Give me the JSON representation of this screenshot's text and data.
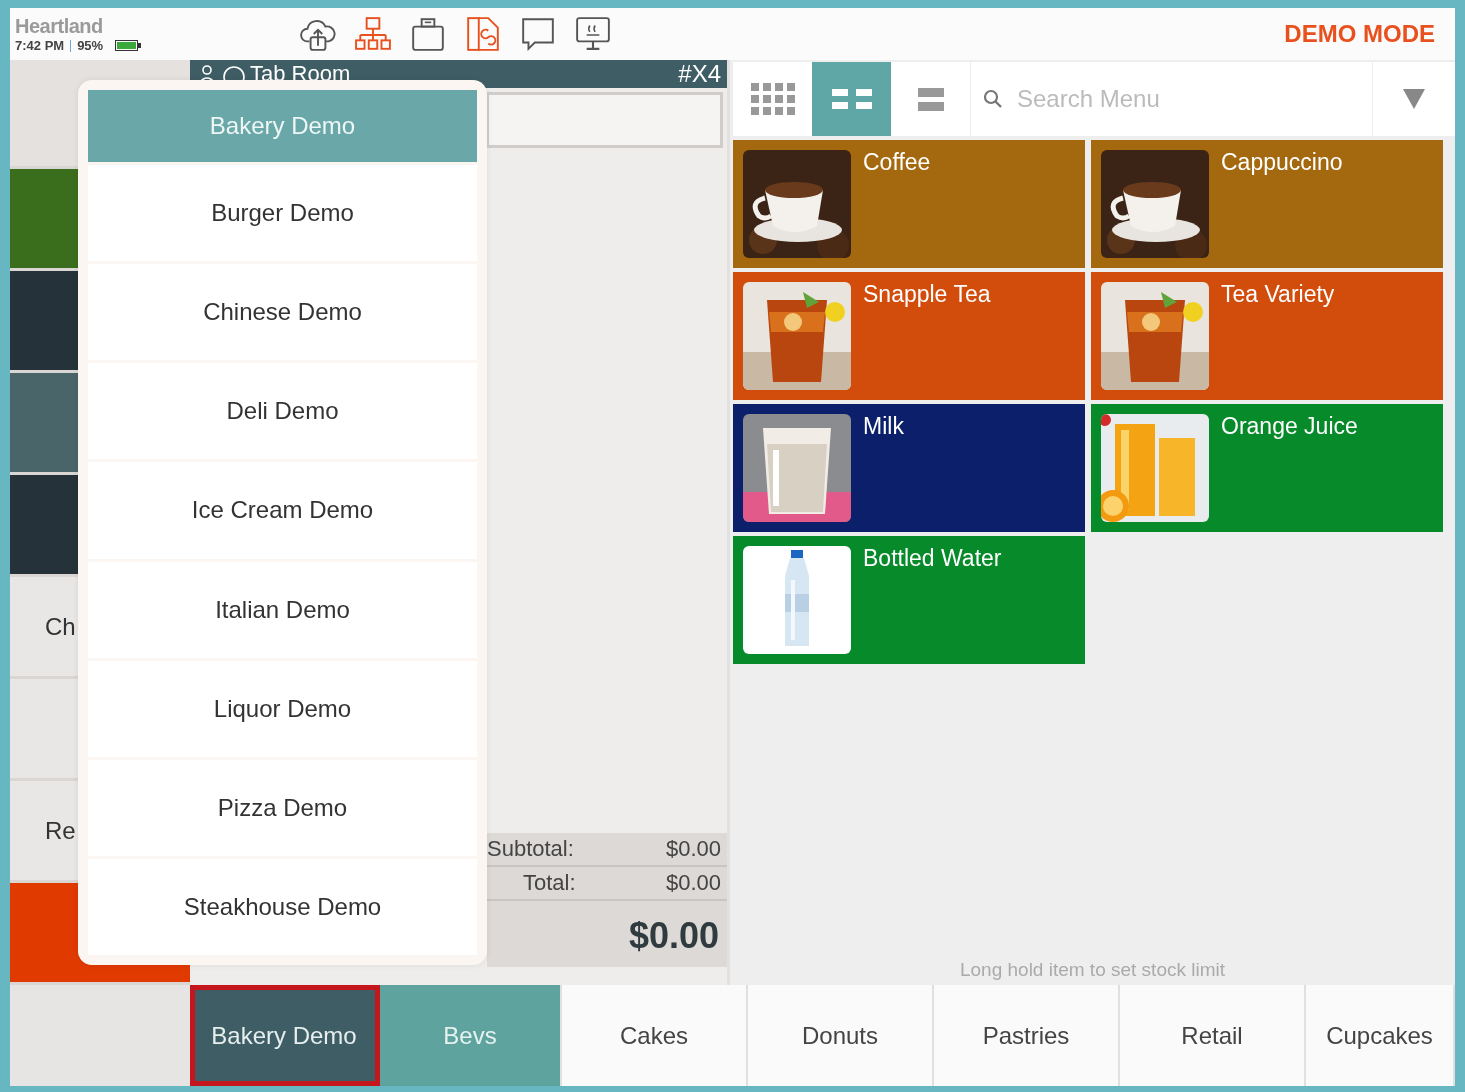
{
  "status_bar": {
    "brand": "Heartland",
    "time": "7:42 PM",
    "battery": "95%"
  },
  "toolbar_icons": [
    {
      "kind": "cloud",
      "color": "#555555"
    },
    {
      "kind": "network",
      "color": "#e8501e"
    },
    {
      "kind": "drawer",
      "color": "#555555"
    },
    {
      "kind": "document",
      "color": "#e8501e"
    },
    {
      "kind": "chat",
      "color": "#555555"
    },
    {
      "kind": "monitor",
      "color": "#555555"
    }
  ],
  "mode_label": "DEMO MODE",
  "side_tiles": [
    {
      "color": "#e4e1de"
    },
    {
      "color": "#3b6e1c"
    },
    {
      "color": "#263239"
    },
    {
      "color": "#4a6569"
    },
    {
      "color": "#263239"
    },
    {
      "color": "#e9e7e5",
      "label": "Ch"
    },
    {
      "color": "#e9e7e5"
    },
    {
      "color": "#e9e7e5",
      "label": "Re"
    },
    {
      "color": "#e03a00"
    }
  ],
  "order": {
    "title": "Tab Room",
    "number": "#X4",
    "subtotal_label": "Subtotal:",
    "subtotal": "$0.00",
    "total_label": "Total:",
    "total": "$0.00",
    "due": "$0.00"
  },
  "menu_picker": {
    "items": [
      {
        "label": "Bakery Demo",
        "selected": true
      },
      {
        "label": "Burger Demo",
        "selected": false
      },
      {
        "label": "Chinese Demo",
        "selected": false
      },
      {
        "label": "Deli Demo",
        "selected": false
      },
      {
        "label": "Ice Cream Demo",
        "selected": false
      },
      {
        "label": "Italian Demo",
        "selected": false
      },
      {
        "label": "Liquor  Demo",
        "selected": false
      },
      {
        "label": "Pizza Demo",
        "selected": false
      },
      {
        "label": "Steakhouse Demo",
        "selected": false
      }
    ]
  },
  "view_buttons": [
    {
      "kind": "grid",
      "selected": false
    },
    {
      "kind": "columns",
      "selected": true
    },
    {
      "kind": "list",
      "selected": false
    }
  ],
  "search": {
    "placeholder": "Search Menu"
  },
  "items": [
    {
      "name": "Coffee",
      "color": "#a4690f",
      "kind": "coffee"
    },
    {
      "name": "Cappuccino",
      "color": "#a4690f",
      "kind": "coffee"
    },
    {
      "name": "Snapple Tea",
      "color": "#d24d0c",
      "kind": "tea"
    },
    {
      "name": "Tea Variety",
      "color": "#d24d0c",
      "kind": "tea"
    },
    {
      "name": "Milk",
      "color": "#0b1f6b",
      "kind": "milk"
    },
    {
      "name": "Orange Juice",
      "color": "#078a2a",
      "kind": "juice"
    },
    {
      "name": "Bottled Water",
      "color": "#078a2a",
      "kind": "water"
    }
  ],
  "hint": "Long hold item to set stock limit",
  "categories": [
    {
      "label": "Bakery Demo",
      "kind": "menu",
      "highlighted": true,
      "selected": false
    },
    {
      "label": "Bevs",
      "kind": "category",
      "highlighted": false,
      "selected": true
    },
    {
      "label": "Cakes",
      "kind": "category",
      "highlighted": false,
      "selected": false
    },
    {
      "label": "Donuts",
      "kind": "category",
      "highlighted": false,
      "selected": false
    },
    {
      "label": "Pastries",
      "kind": "category",
      "highlighted": false,
      "selected": false
    },
    {
      "label": "Retail",
      "kind": "category",
      "highlighted": false,
      "selected": false
    },
    {
      "label": "Cupcakes",
      "kind": "category",
      "highlighted": false,
      "selected": false
    }
  ]
}
